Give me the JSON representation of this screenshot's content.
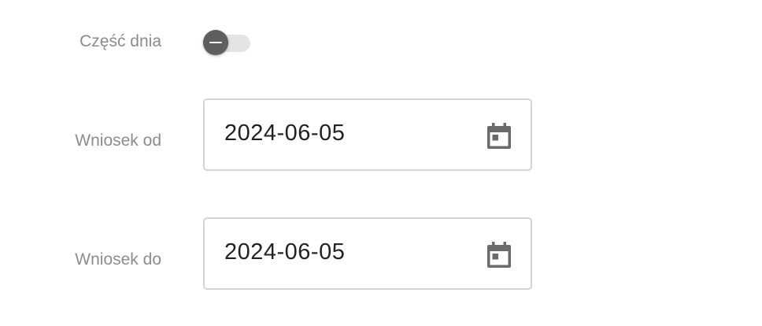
{
  "form": {
    "part_day_label": "Część dnia",
    "part_day_toggle": {
      "on": false
    },
    "from_label": "Wniosek od",
    "from_value": "2024-06-05",
    "to_label": "Wniosek do",
    "to_value": "2024-06-05"
  },
  "icons": {
    "toggle_knob": "minus-icon",
    "date_picker": "calendar-icon"
  },
  "colors": {
    "label": "#8c8c8c",
    "knob": "#5f5f5f",
    "track": "#e4e4e4",
    "field_border": "#d4d4d4",
    "icon": "#6b6b6b"
  }
}
